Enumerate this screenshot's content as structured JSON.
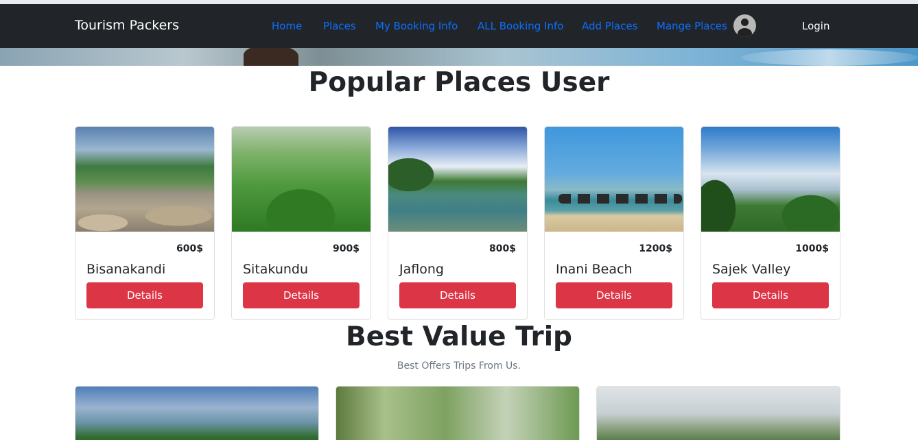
{
  "navbar": {
    "brand": "Tourism Packers",
    "links": [
      "Home",
      "Places",
      "My Booking Info",
      "ALL Booking Info",
      "Add Places",
      "Mange Places"
    ],
    "login": "Login",
    "link_color": "#0d6efd",
    "background": "#212529"
  },
  "popular": {
    "title": "Popular Places User",
    "places": [
      {
        "name": "Bisanakandi",
        "price": "600$",
        "button": "Details"
      },
      {
        "name": "Sitakundu",
        "price": "900$",
        "button": "Details"
      },
      {
        "name": "Jaflong",
        "price": "800$",
        "button": "Details"
      },
      {
        "name": "Inani Beach",
        "price": "1200$",
        "button": "Details"
      },
      {
        "name": "Sajek Valley",
        "price": "1000$",
        "button": "Details"
      }
    ],
    "button_color": "#dc3545"
  },
  "best_value": {
    "title": "Best Value Trip",
    "subtitle": "Best Offers Trips From Us."
  }
}
